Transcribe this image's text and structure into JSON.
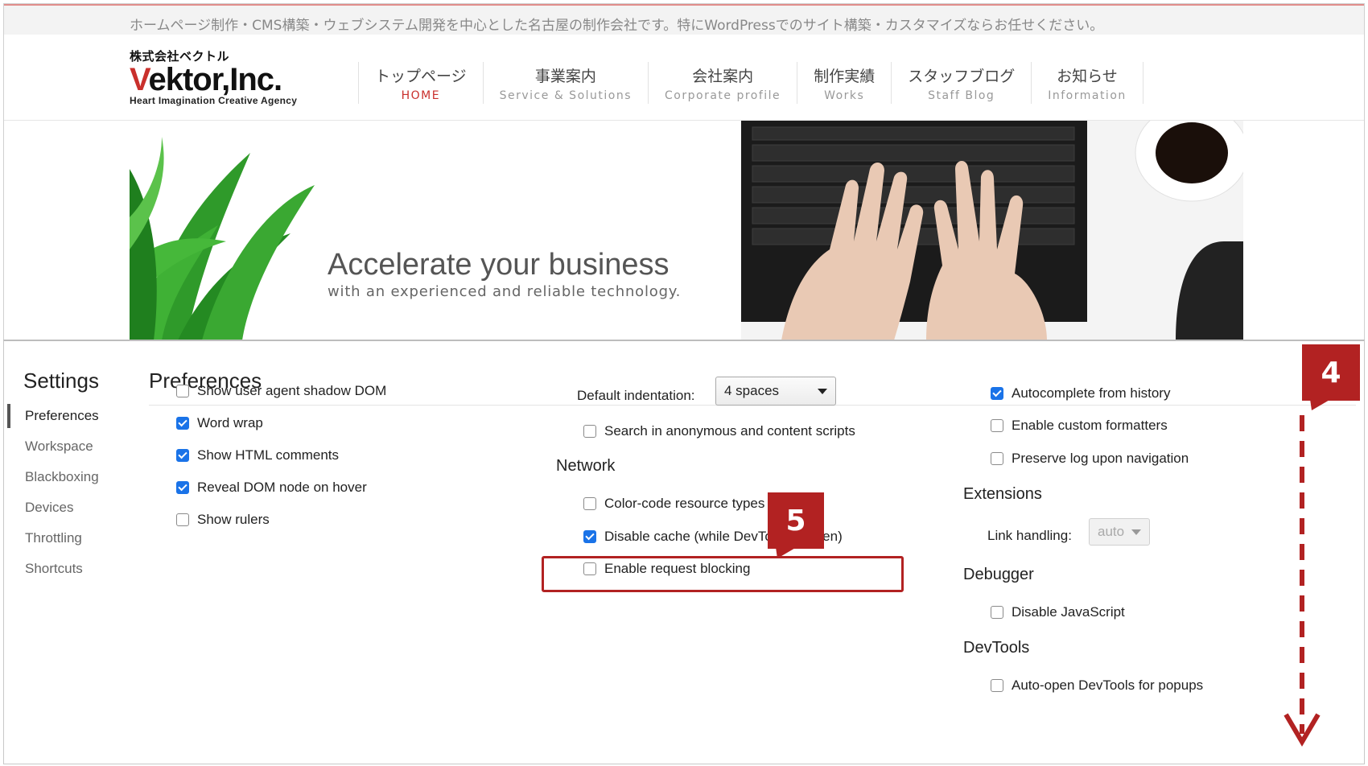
{
  "site": {
    "tagline": "ホームページ制作・CMS構築・ウェブシステム開発を中心とした名古屋の制作会社です。特にWordPressでのサイト構築・カスタマイズならお任せください。",
    "logo": {
      "small": "株式会社ベクトル",
      "main_v": "V",
      "main_rest": "ektor,Inc.",
      "sub": "Heart Imagination Creative Agency"
    },
    "nav": [
      {
        "jp": "トップページ",
        "en": "HOME",
        "active": true
      },
      {
        "jp": "事業案内",
        "en": "Service & Solutions",
        "active": false
      },
      {
        "jp": "会社案内",
        "en": "Corporate profile",
        "active": false
      },
      {
        "jp": "制作実績",
        "en": "Works",
        "active": false
      },
      {
        "jp": "スタッフブログ",
        "en": "Staff Blog",
        "active": false
      },
      {
        "jp": "お知らせ",
        "en": "Information",
        "active": false
      }
    ],
    "hero": {
      "title": "Accelerate your business",
      "subtitle": "with an experienced and reliable technology."
    }
  },
  "devtools": {
    "title": "Settings",
    "sidebar": [
      {
        "label": "Preferences",
        "selected": true
      },
      {
        "label": "Workspace",
        "selected": false
      },
      {
        "label": "Blackboxing",
        "selected": false
      },
      {
        "label": "Devices",
        "selected": false
      },
      {
        "label": "Throttling",
        "selected": false
      },
      {
        "label": "Shortcuts",
        "selected": false
      }
    ],
    "pane_title": "Preferences",
    "col1": [
      {
        "label": "Show user agent shadow DOM",
        "checked": false
      },
      {
        "label": "Word wrap",
        "checked": true
      },
      {
        "label": "Show HTML comments",
        "checked": true
      },
      {
        "label": "Reveal DOM node on hover",
        "checked": true
      },
      {
        "label": "Show rulers",
        "checked": false
      }
    ],
    "col2": {
      "indent_label": "Default indentation:",
      "indent_value": "4 spaces",
      "search_anon": {
        "label": "Search in anonymous and content scripts",
        "checked": false
      },
      "network_title": "Network",
      "network": [
        {
          "label": "Color-code resource types",
          "checked": false
        },
        {
          "label": "Disable cache (while DevTools is open)",
          "checked": true
        },
        {
          "label": "Enable request blocking",
          "checked": false
        }
      ]
    },
    "col3": {
      "top": [
        {
          "label": "Autocomplete from history",
          "checked": true
        },
        {
          "label": "Enable custom formatters",
          "checked": false
        },
        {
          "label": "Preserve log upon navigation",
          "checked": false
        }
      ],
      "extensions_title": "Extensions",
      "link_handling_label": "Link handling:",
      "link_handling_value": "auto",
      "debugger_title": "Debugger",
      "disable_js": {
        "label": "Disable JavaScript",
        "checked": false
      },
      "devtools_title": "DevTools",
      "auto_open": {
        "label": "Auto-open DevTools for popups",
        "checked": false
      }
    }
  },
  "annotations": {
    "badge4": "4",
    "badge5": "5",
    "color": "#b22222"
  }
}
